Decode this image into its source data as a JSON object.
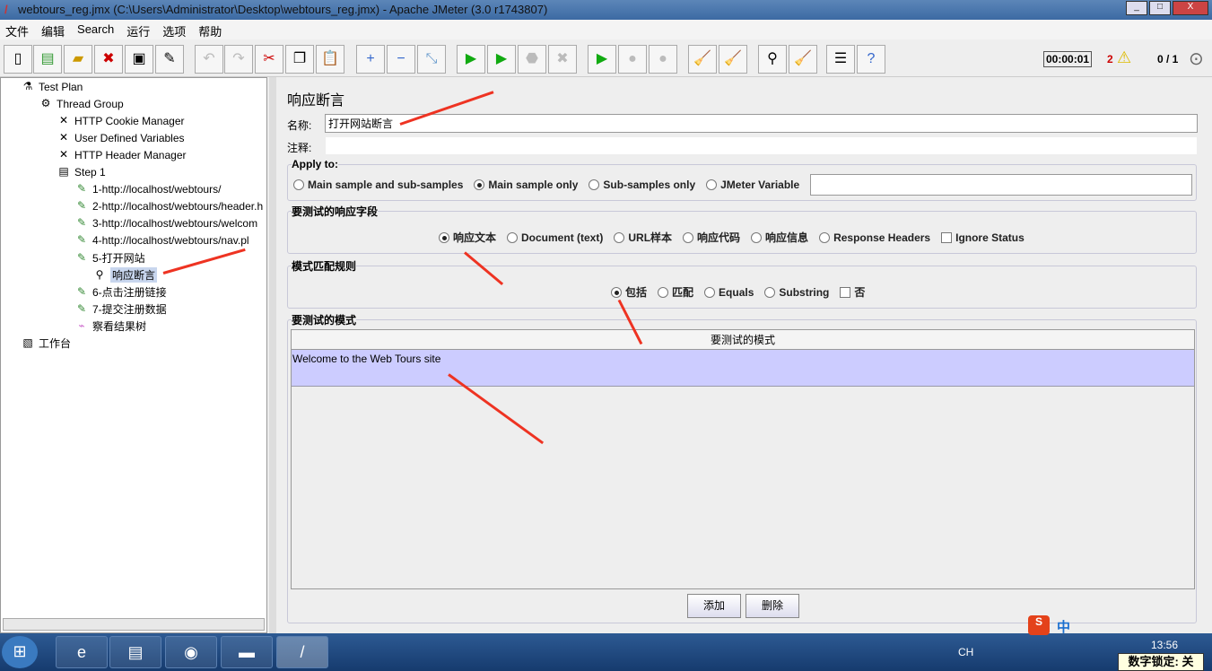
{
  "window": {
    "title": "webtours_reg.jmx (C:\\Users\\Administrator\\Desktop\\webtours_reg.jmx) - Apache JMeter (3.0 r1743807)"
  },
  "menu": [
    "文件",
    "编辑",
    "Search",
    "运行",
    "选项",
    "帮助"
  ],
  "status": {
    "timer": "00:00:01",
    "warnings": "2",
    "threads": "0 / 1"
  },
  "tree": [
    {
      "label": "Test Plan",
      "icon": "flask-icon"
    },
    {
      "label": "Thread Group",
      "icon": "gear-icon"
    },
    {
      "label": "HTTP Cookie Manager",
      "icon": "wrench-icon"
    },
    {
      "label": "User Defined Variables",
      "icon": "wrench-icon"
    },
    {
      "label": "HTTP Header Manager",
      "icon": "wrench-icon"
    },
    {
      "label": "Step 1",
      "icon": "controller-icon"
    },
    {
      "label": "1-http://localhost/webtours/",
      "icon": "pipette-icon"
    },
    {
      "label": "2-http://localhost/webtours/header.h",
      "icon": "pipette-icon"
    },
    {
      "label": "3-http://localhost/webtours/welcom",
      "icon": "pipette-icon"
    },
    {
      "label": "4-http://localhost/webtours/nav.pl",
      "icon": "pipette-icon"
    },
    {
      "label": "5-打开网站",
      "icon": "pipette-icon"
    },
    {
      "label": "响应断言",
      "icon": "magnifier-icon"
    },
    {
      "label": "6-点击注册链接",
      "icon": "pipette-icon"
    },
    {
      "label": "7-提交注册数据",
      "icon": "pipette-icon"
    },
    {
      "label": "察看结果树",
      "icon": "chart-icon"
    },
    {
      "label": "工作台",
      "icon": "clipboard-icon"
    }
  ],
  "panel": {
    "title": "响应断言",
    "name_label": "名称:",
    "name_value": "打开网站断言",
    "comment_label": "注释:",
    "comment_value": "",
    "apply_to": {
      "legend": "Apply to:",
      "options": [
        "Main sample and sub-samples",
        "Main sample only",
        "Sub-samples only",
        "JMeter Variable"
      ],
      "selected": 1,
      "variable_value": ""
    },
    "field": {
      "legend": "要测试的响应字段",
      "options": [
        "响应文本",
        "Document (text)",
        "URL样本",
        "响应代码",
        "响应信息",
        "Response Headers"
      ],
      "selected": 0,
      "ignore_status": "Ignore Status"
    },
    "rules": {
      "legend": "模式匹配规则",
      "options": [
        "包括",
        "匹配",
        "Equals",
        "Substring"
      ],
      "selected": 0,
      "not": "否"
    },
    "patterns": {
      "legend": "要测试的模式",
      "column": "要测试的模式",
      "rows": [
        "Welcome to the Web Tours site"
      ]
    },
    "add": "添加",
    "delete": "删除"
  },
  "taskbar": {
    "lang": "CH",
    "time": "13:56",
    "numlock": "数字锁定: 关",
    "ime": "中"
  },
  "colors": {
    "selected_row": "#ccccff",
    "arrow": "#e32222"
  }
}
